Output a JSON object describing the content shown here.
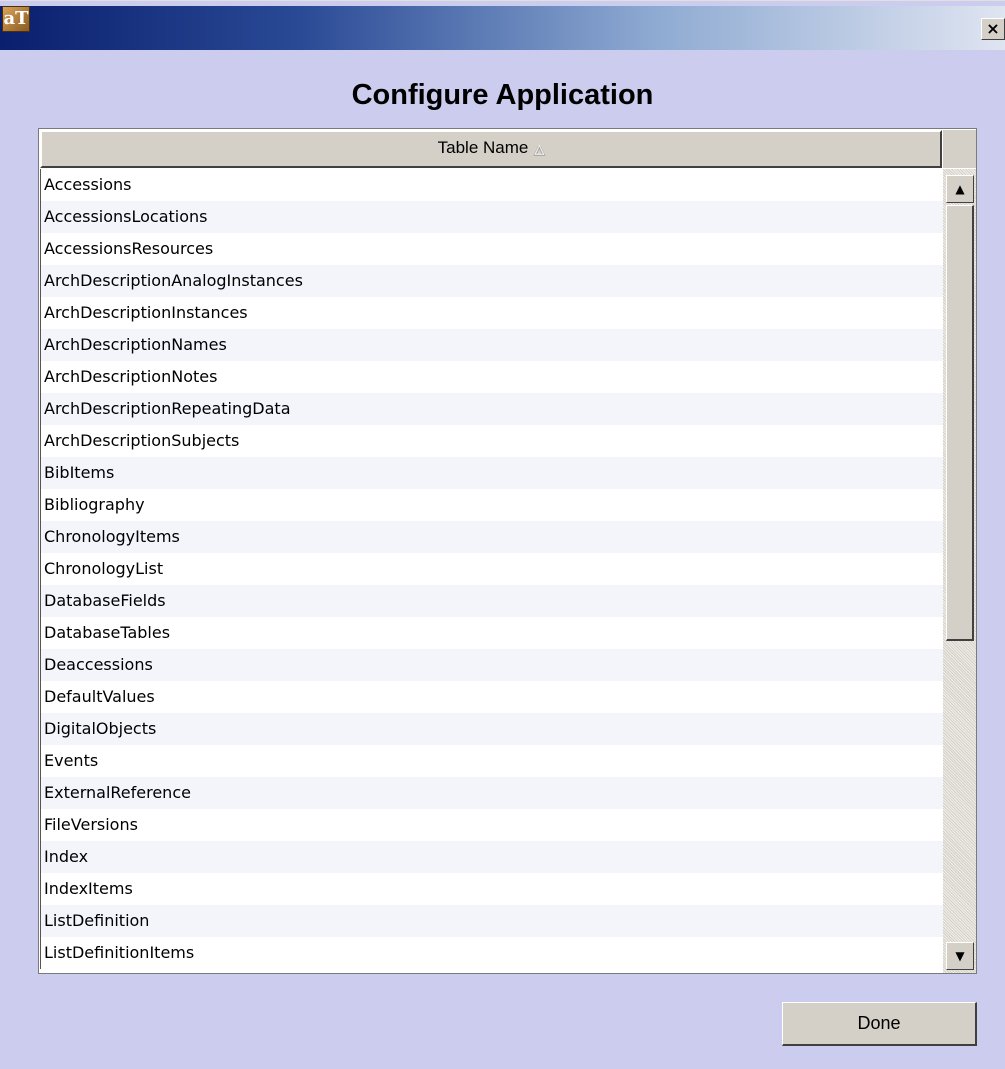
{
  "window": {
    "app_icon_text": "aT",
    "close_label": "×"
  },
  "dialog": {
    "title": "Configure Application"
  },
  "table": {
    "column_header": "Table Name",
    "sort_icon": "△",
    "rows": [
      "Accessions",
      "AccessionsLocations",
      "AccessionsResources",
      "ArchDescriptionAnalogInstances",
      "ArchDescriptionInstances",
      "ArchDescriptionNames",
      "ArchDescriptionNotes",
      "ArchDescriptionRepeatingData",
      "ArchDescriptionSubjects",
      "BibItems",
      "Bibliography",
      "ChronologyItems",
      "ChronologyList",
      "DatabaseFields",
      "DatabaseTables",
      "Deaccessions",
      "DefaultValues",
      "DigitalObjects",
      "Events",
      "ExternalReference",
      "FileVersions",
      "Index",
      "IndexItems",
      "ListDefinition",
      "ListDefinitionItems"
    ]
  },
  "scrollbar": {
    "up_icon": "▲",
    "down_icon": "▼"
  },
  "buttons": {
    "done_label": "Done"
  }
}
